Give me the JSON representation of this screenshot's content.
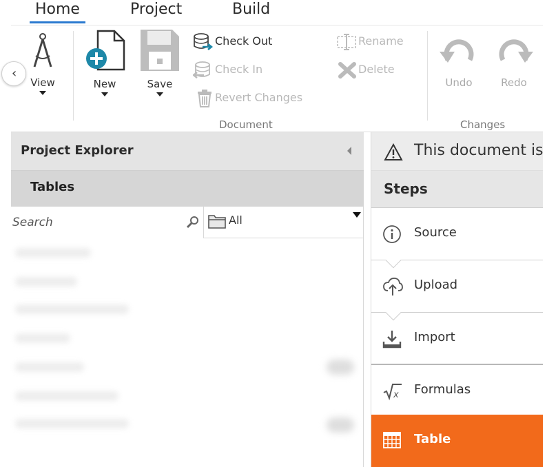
{
  "tabs": [
    {
      "label": "Home"
    },
    {
      "label": "Project"
    },
    {
      "label": "Build"
    }
  ],
  "ribbon": {
    "view_label": "View",
    "new_label": "New",
    "save_label": "Save",
    "check_out": "Check Out",
    "check_in": "Check In",
    "revert_changes": "Revert Changes",
    "rename": "Rename",
    "delete": "Delete",
    "undo": "Undo",
    "redo": "Redo",
    "group_document": "Document",
    "group_changes": "Changes"
  },
  "explorer": {
    "title": "Project Explorer",
    "section": "Tables",
    "search_placeholder": "Search",
    "filter_value": "All"
  },
  "right": {
    "notice": "This document is r",
    "steps_title": "Steps",
    "steps": [
      {
        "label": "Source",
        "icon": "info-icon"
      },
      {
        "label": "Upload",
        "icon": "cloud-upload-icon"
      },
      {
        "label": "Import",
        "icon": "import-tray-icon"
      },
      {
        "label": "Formulas",
        "icon": "formula-icon"
      },
      {
        "label": "Table",
        "icon": "table-grid-icon"
      }
    ]
  },
  "colors": {
    "accent_blue": "#2a7ad0",
    "active_step": "#f26a1b",
    "new_button_teal": "#1e88a8"
  }
}
